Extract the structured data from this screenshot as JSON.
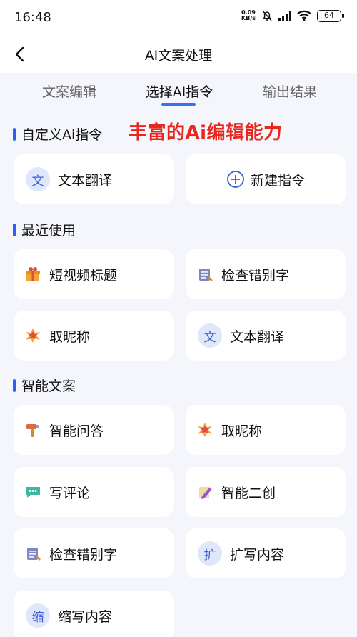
{
  "status": {
    "time": "16:48",
    "net_speed_top": "0.09",
    "net_speed_bottom": "KB/s",
    "battery": "64"
  },
  "nav": {
    "title": "AI文案处理"
  },
  "tabs": [
    {
      "label": "文案编辑"
    },
    {
      "label": "选择AI指令"
    },
    {
      "label": "输出结果"
    }
  ],
  "promo": "丰富的Ai编辑能力",
  "sections": {
    "custom": {
      "title": "自定义Ai指令",
      "items": [
        {
          "icon_char": "文",
          "label": "文本翻译"
        },
        {
          "icon": "plus-circle-icon",
          "label": "新建指令"
        }
      ]
    },
    "recent": {
      "title": "最近使用",
      "items": [
        {
          "icon": "gift-box-icon",
          "label": "短视频标题"
        },
        {
          "icon": "scroll-icon",
          "label": "检查错别字"
        },
        {
          "icon": "comic-burst-icon",
          "label": "取昵称"
        },
        {
          "icon_char": "文",
          "label": "文本翻译"
        }
      ]
    },
    "smart": {
      "title": "智能文案",
      "items": [
        {
          "icon": "hammer-icon",
          "label": "智能问答"
        },
        {
          "icon": "comic-burst-icon",
          "label": "取昵称"
        },
        {
          "icon": "chat-bubble-icon",
          "label": "写评论"
        },
        {
          "icon": "pencil-paper-icon",
          "label": "智能二创"
        },
        {
          "icon": "scroll-icon",
          "label": "检查错别字"
        },
        {
          "icon_char": "扩",
          "label": "扩写内容"
        },
        {
          "icon_char": "缩",
          "label": "缩写内容"
        }
      ]
    }
  },
  "colors": {
    "accent": "#2f5ef0",
    "promo": "#e8281f",
    "background": "#f4f6fb"
  }
}
